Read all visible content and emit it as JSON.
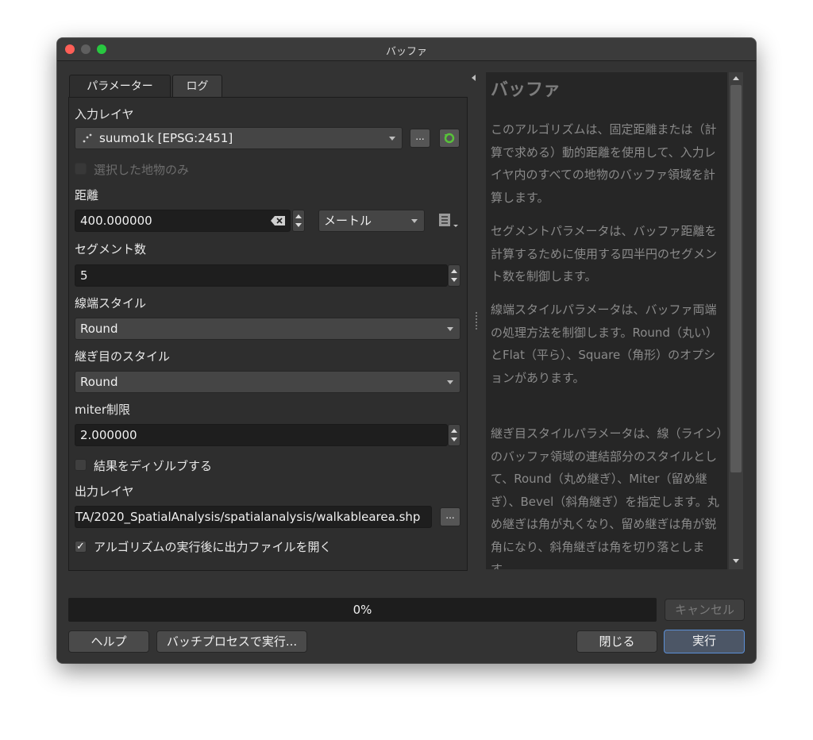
{
  "window": {
    "title": "バッファ"
  },
  "tabs": [
    {
      "label": "パラメーター"
    },
    {
      "label": "ログ"
    }
  ],
  "params": {
    "input_layer_label": "入力レイヤ",
    "input_layer_value": "suumo1k [EPSG:2451]",
    "selected_only_label": "選択した地物のみ",
    "distance_label": "距離",
    "distance_value": "400.000000",
    "distance_unit": "メートル",
    "segments_label": "セグメント数",
    "segments_value": "5",
    "end_cap_label": "線端スタイル",
    "end_cap_value": "Round",
    "join_label": "継ぎ目のスタイル",
    "join_value": "Round",
    "miter_label": "miter制限",
    "miter_value": "2.000000",
    "dissolve_label": "結果をディゾルブする",
    "output_label": "出力レイヤ",
    "output_value": "TA/2020_SpatialAnalysis/spatialanalysis/walkablearea.shp",
    "open_output_label": "アルゴリズムの実行後に出力ファイルを開く",
    "browse_label": "...",
    "check_mark": "✓"
  },
  "help": {
    "title": "バッファ",
    "p1": "このアルゴリズムは、固定距離または（計算で求める）動的距離を使用して、入力レイヤ内のすべての地物のバッファ領域を計算します。",
    "p2": "セグメントパラメータは、バッファ距離を計算するために使用する四半円のセグメント数を制御します。",
    "p3": "線端スタイルパラメータは、バッファ両端の処理方法を制御します。Round（丸い）とFlat（平ら）、Square（角形）のオプションがあります。",
    "p4": "継ぎ目スタイルパラメータは、線（ライン）のバッファ領域の連結部分のスタイルとして、Round（丸め継ぎ）、Miter（留め継ぎ）、Bevel（斜角継ぎ）を指定します。丸め継ぎは角が丸くなり、留め継ぎは角が鋭角になり、斜角継ぎは角を切り落とします。"
  },
  "footer": {
    "progress_text": "0%",
    "progress_fraction": 0,
    "cancel_label": "キャンセル",
    "help_label": "ヘルプ",
    "batch_label": "バッチプロセスで実行...",
    "close_label": "閉じる",
    "run_label": "実行"
  },
  "colors": {
    "accent": "#3a7bd5",
    "run_border": "#5b8fd6",
    "help_text": "#8a8a8a"
  }
}
